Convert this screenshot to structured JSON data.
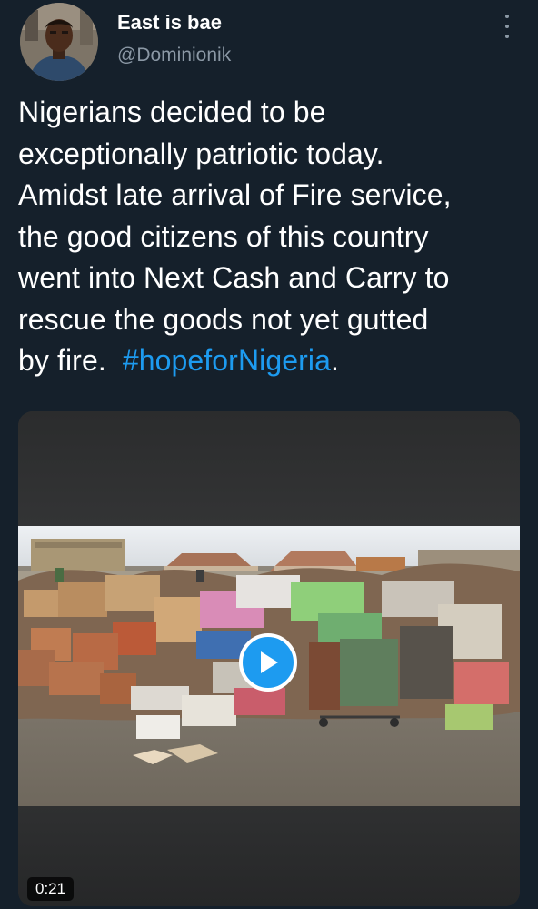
{
  "tweet": {
    "author": {
      "display_name": "East is bae",
      "handle": "@Dominionik",
      "avatar_icon": "profile-photo"
    },
    "more_icon": "vertical-ellipsis-icon",
    "text_lines": [
      "Nigerians decided to be",
      "exceptionally patriotic today.",
      "Amidst late arrival of Fire service,",
      "the good citizens of this country",
      "went into Next Cash and Carry to",
      "rescue the goods not yet gutted"
    ],
    "last_line_prefix": "by fire.  ",
    "hashtag": "#hopeforNigeria",
    "last_line_suffix": ".",
    "media": {
      "type": "video",
      "duration": "0:21",
      "play_icon": "play-icon"
    }
  },
  "colors": {
    "background": "#15202b",
    "text": "#ffffff",
    "secondary_text": "#8b98a5",
    "accent": "#1d9bf0"
  }
}
